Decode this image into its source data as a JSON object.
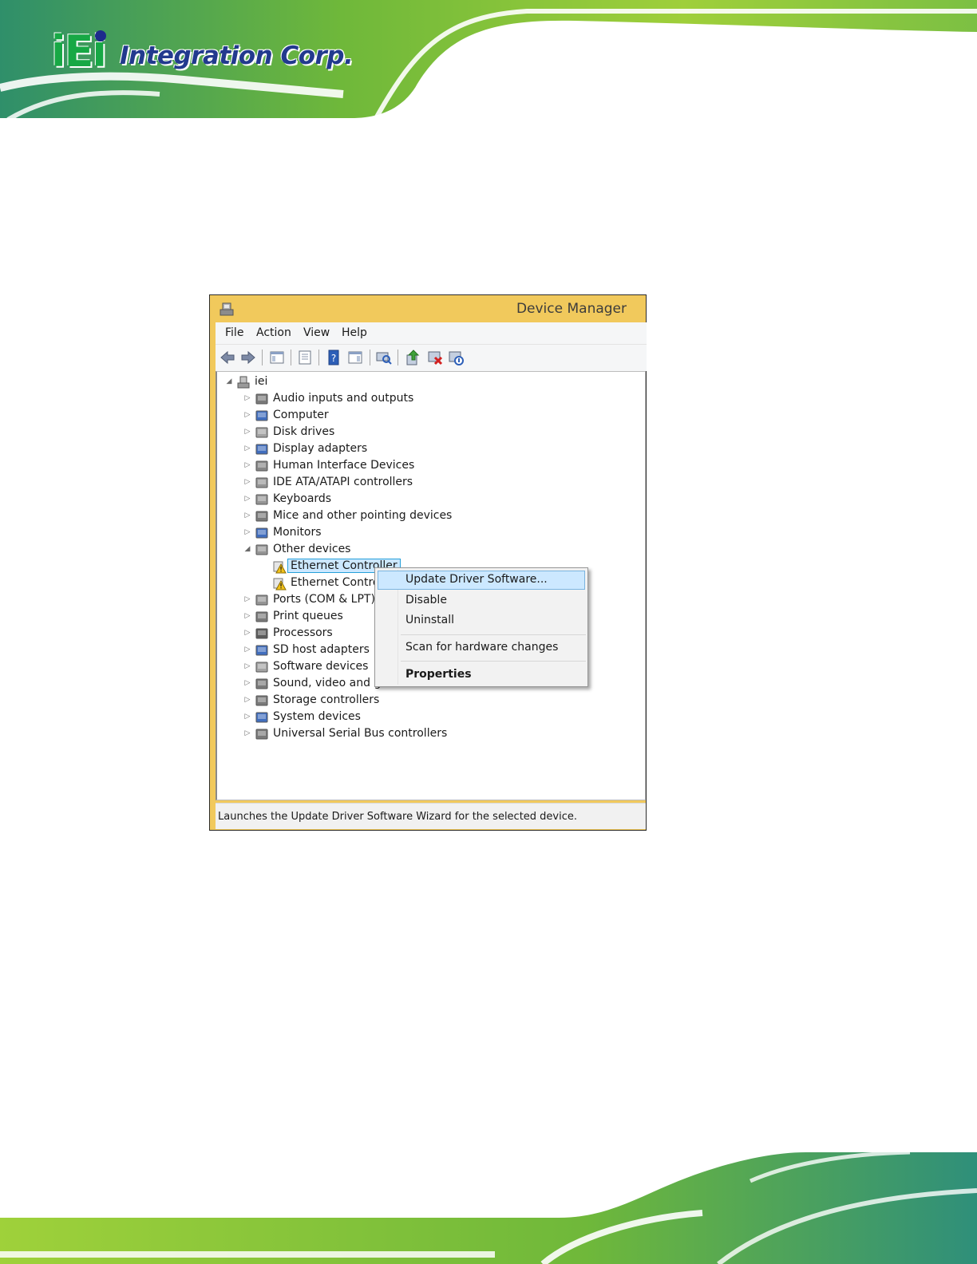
{
  "header": {
    "logo_mark": "iEi",
    "logo_text": "Integration Corp."
  },
  "window": {
    "title": "Device Manager",
    "menu": [
      "File",
      "Action",
      "View",
      "Help"
    ],
    "toolbar_icons": [
      "back-icon",
      "forward-icon",
      "show-hide-console-tree-icon",
      "properties-icon",
      "help-icon",
      "action-pane-icon",
      "scan-hardware-icon",
      "update-driver-icon",
      "uninstall-icon",
      "disable-icon"
    ],
    "tree": {
      "root": "iei",
      "items": [
        {
          "label": "Audio inputs and outputs",
          "icon": "speaker-icon"
        },
        {
          "label": "Computer",
          "icon": "computer-icon"
        },
        {
          "label": "Disk drives",
          "icon": "disk-icon"
        },
        {
          "label": "Display adapters",
          "icon": "display-adapter-icon"
        },
        {
          "label": "Human Interface Devices",
          "icon": "hid-icon"
        },
        {
          "label": "IDE ATA/ATAPI controllers",
          "icon": "ide-icon"
        },
        {
          "label": "Keyboards",
          "icon": "keyboard-icon"
        },
        {
          "label": "Mice and other pointing devices",
          "icon": "mouse-icon"
        },
        {
          "label": "Monitors",
          "icon": "monitor-icon"
        },
        {
          "label": "Other devices",
          "icon": "unknown-device-icon"
        },
        {
          "label": "Ethernet Controller",
          "icon": "warning-device-icon"
        },
        {
          "label": "Ethernet Control",
          "icon": "warning-device-icon"
        },
        {
          "label": "Ports (COM & LPT)",
          "icon": "port-icon"
        },
        {
          "label": "Print queues",
          "icon": "printer-icon"
        },
        {
          "label": "Processors",
          "icon": "processor-icon"
        },
        {
          "label": "SD host adapters",
          "icon": "sd-icon"
        },
        {
          "label": "Software devices",
          "icon": "software-device-icon"
        },
        {
          "label": "Sound, video and ga",
          "icon": "sound-icon"
        },
        {
          "label": "Storage controllers",
          "icon": "storage-icon"
        },
        {
          "label": "System devices",
          "icon": "system-icon"
        },
        {
          "label": "Universal Serial Bus controllers",
          "icon": "usb-icon"
        }
      ]
    },
    "status": "Launches the Update Driver Software Wizard for the selected device."
  },
  "context_menu": {
    "update": "Update Driver Software...",
    "disable": "Disable",
    "uninstall": "Uninstall",
    "scan": "Scan for hardware changes",
    "properties": "Properties"
  },
  "colors": {
    "title_bar": "#f1c95c",
    "selection": "#cce8ff",
    "brand_green": "#17a845",
    "brand_blue": "#223a8e"
  }
}
